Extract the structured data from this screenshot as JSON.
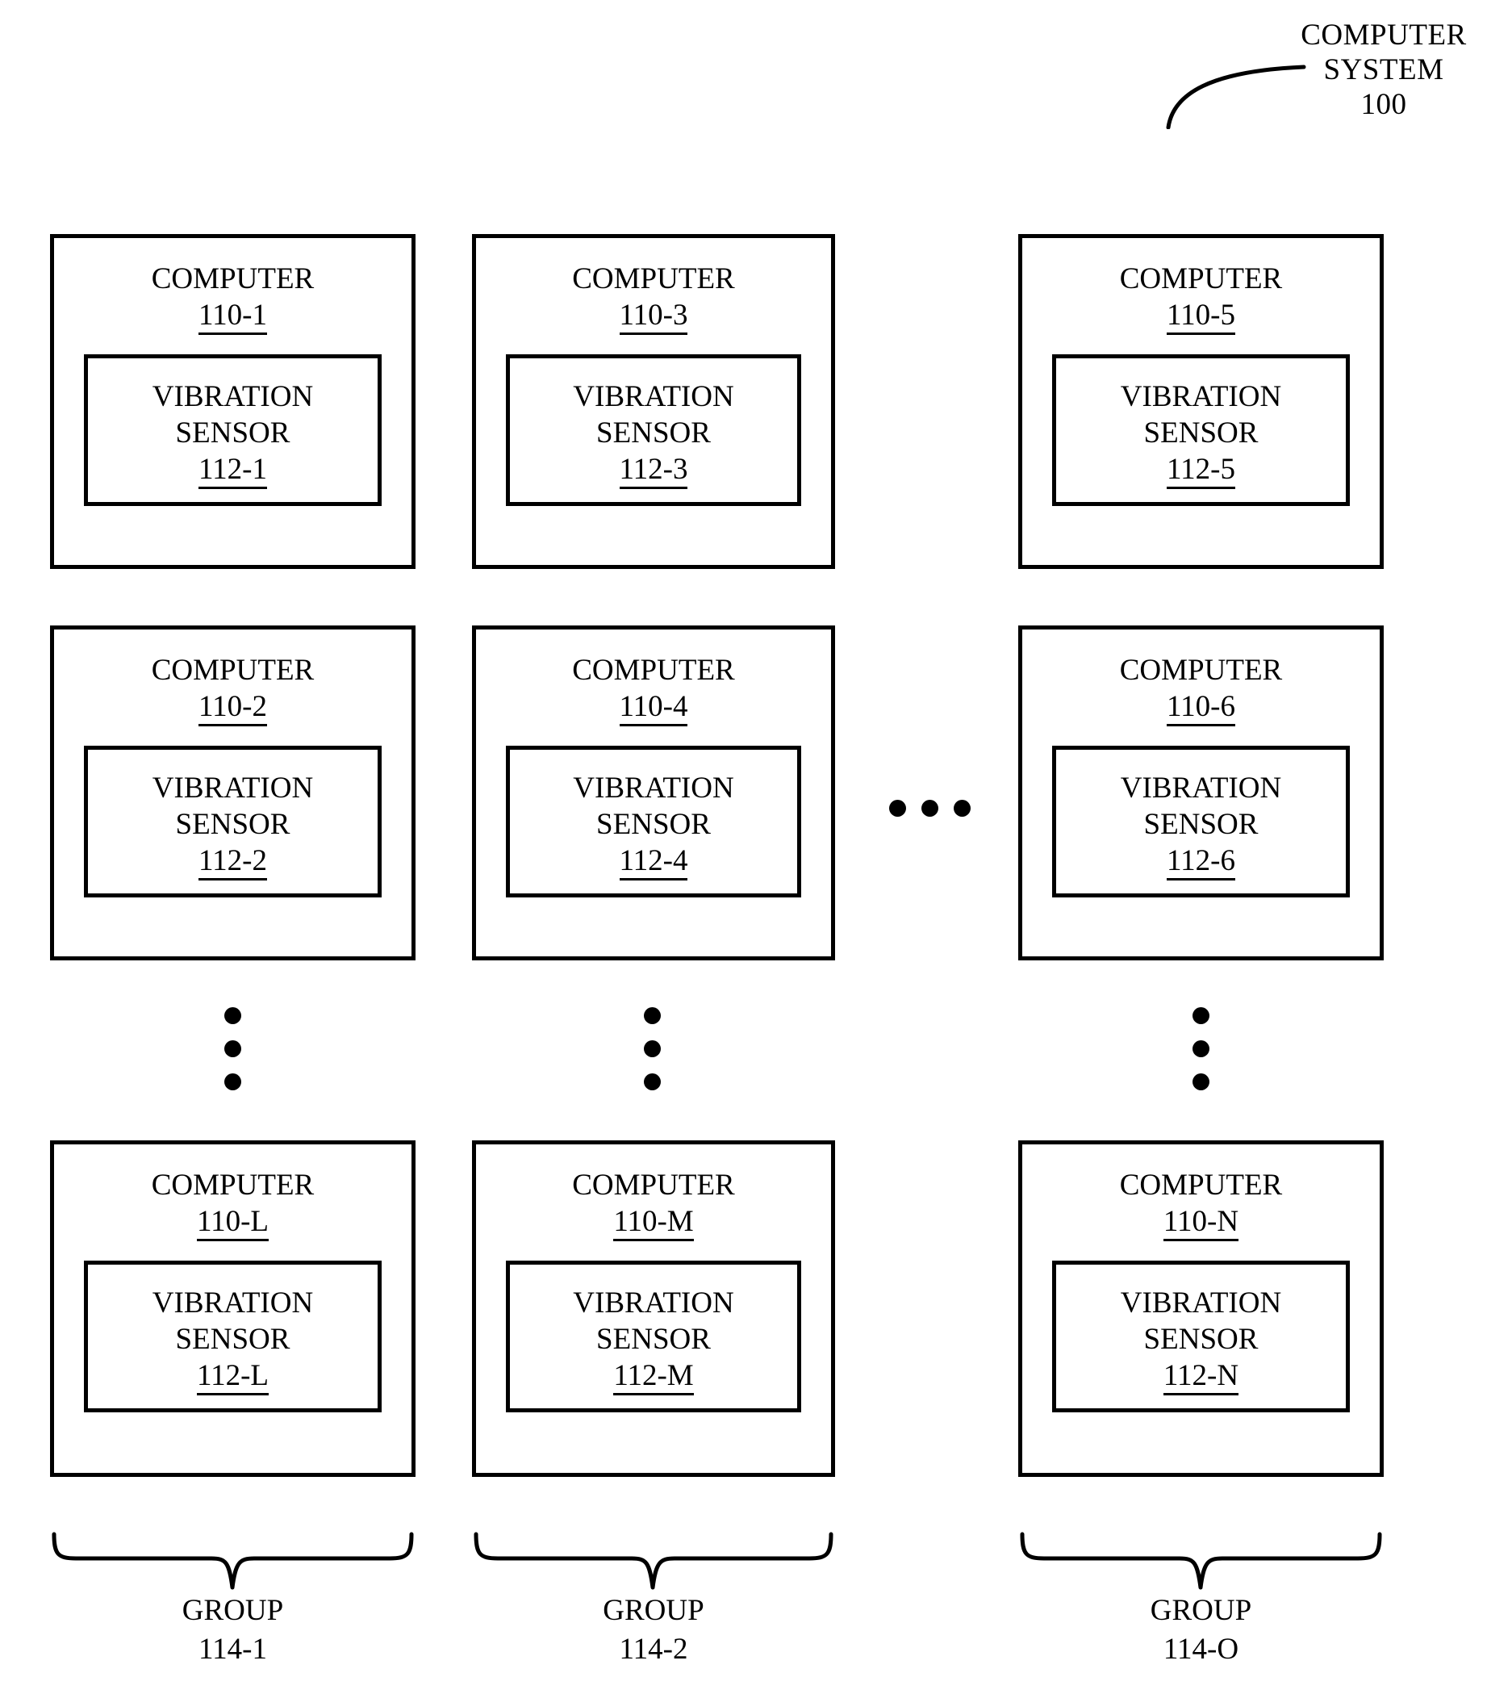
{
  "figure": {
    "system_label_line1": "COMPUTER",
    "system_label_line2": "SYSTEM",
    "system_label_ref": "100"
  },
  "labels": {
    "computer": "COMPUTER",
    "sensor_line1": "VIBRATION",
    "sensor_line2": "SENSOR",
    "group": "GROUP"
  },
  "columns": [
    {
      "group_ref": "114-1",
      "computers": [
        {
          "computer_ref": "110-1",
          "sensor_ref": "112-1"
        },
        {
          "computer_ref": "110-2",
          "sensor_ref": "112-2"
        },
        {
          "computer_ref": "110-L",
          "sensor_ref": "112-L"
        }
      ]
    },
    {
      "group_ref": "114-2",
      "computers": [
        {
          "computer_ref": "110-3",
          "sensor_ref": "112-3"
        },
        {
          "computer_ref": "110-4",
          "sensor_ref": "112-4"
        },
        {
          "computer_ref": "110-M",
          "sensor_ref": "112-M"
        }
      ]
    },
    {
      "group_ref": "114-O",
      "computers": [
        {
          "computer_ref": "110-5",
          "sensor_ref": "112-5"
        },
        {
          "computer_ref": "110-6",
          "sensor_ref": "112-6"
        },
        {
          "computer_ref": "110-N",
          "sensor_ref": "112-N"
        }
      ]
    }
  ],
  "style": {
    "line_color": "#000000",
    "background": "#ffffff"
  }
}
